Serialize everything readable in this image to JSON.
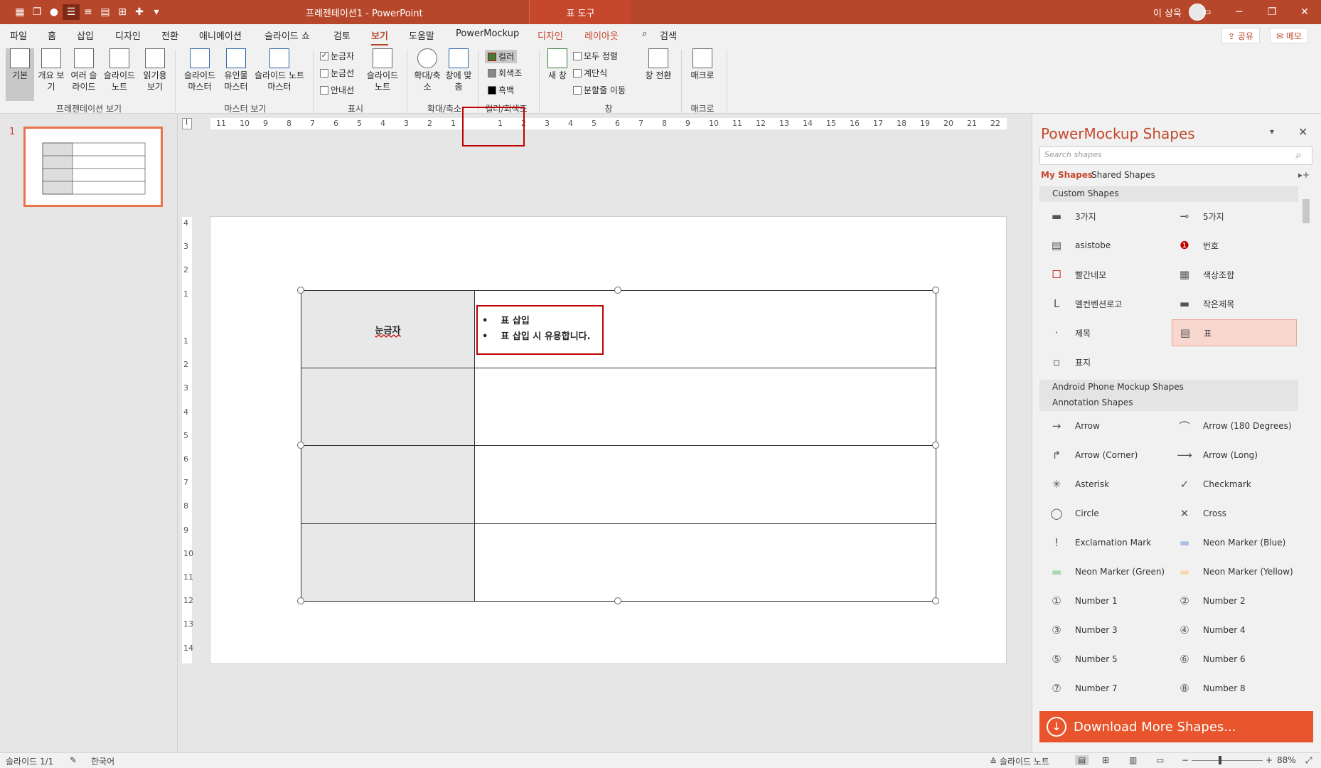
{
  "app": {
    "title": "프레젠테이션1 - PowerPoint",
    "context_tab": "표 도구",
    "user": "이 상욱"
  },
  "tabs": [
    "파일",
    "홈",
    "삽입",
    "디자인",
    "전환",
    "애니메이션",
    "슬라이드 쇼",
    "검토",
    "보기",
    "도움말",
    "PowerMockup",
    "디자인",
    "레이아웃"
  ],
  "search_label": "검색",
  "share_label": "공유",
  "memo_label": "메모",
  "ribbon": {
    "normal": "기본",
    "outline": "개요 보기",
    "sorter": "여러 슬라이드",
    "notes": "슬라이드 노트",
    "reading": "읽기용 보기",
    "slide_master": "슬라이드 마스터",
    "handout_master": "유인물 마스터",
    "notes_master": "슬라이드 노트 마스터",
    "ruler": "눈금자",
    "gridlines": "눈금선",
    "guides": "안내선",
    "notes_pane": "슬라이드 노트",
    "zoom": "확대/축소",
    "fit": "창에 맞춤",
    "color": "컬러",
    "grayscale": "회색조",
    "bw": "흑백",
    "new_window": "새 창",
    "arrange_all": "모두 정렬",
    "cascade": "계단식",
    "move_split": "분할줄 이동",
    "switch_windows": "창 전환",
    "macros": "매크로",
    "groups": [
      "프레젠테이션 보기",
      "마스터 보기",
      "표시",
      "확대/축소",
      "컬러/회색조",
      "창",
      "매크로"
    ]
  },
  "slides": {
    "number": "1"
  },
  "table": {
    "header_cell": "눈금자",
    "bullets": [
      "표 삽입",
      "표 삽입 시 유용합니다."
    ]
  },
  "ruler_h": [
    "11",
    "10",
    "9",
    "8",
    "7",
    "6",
    "5",
    "4",
    "3",
    "2",
    "1",
    "",
    "1",
    "2",
    "3",
    "4",
    "5",
    "6",
    "7",
    "8",
    "9",
    "10",
    "11",
    "12",
    "13",
    "14",
    "15",
    "16",
    "17",
    "18",
    "19",
    "20",
    "21",
    "22"
  ],
  "ruler_v": [
    "4",
    "3",
    "2",
    "1",
    "",
    "1",
    "2",
    "3",
    "4",
    "5",
    "6",
    "7",
    "8",
    "9",
    "10",
    "11",
    "12",
    "13",
    "14"
  ],
  "pm": {
    "title": "PowerMockup Shapes",
    "search_placeholder": "Search shapes",
    "my_shapes": "My Shapes",
    "shared_shapes": "Shared Shapes",
    "sec_custom": "Custom Shapes",
    "custom": [
      "3가지",
      "5가지",
      "asistobe",
      "번호",
      "빨간네모",
      "색상조합",
      "엘컨벤션로고",
      "작은제목",
      "제목",
      "표",
      "표지"
    ],
    "sec_android": "Android Phone Mockup Shapes",
    "sec_annotation": "Annotation Shapes",
    "annotation": [
      "Arrow",
      "Arrow (180 Degrees)",
      "Arrow (Corner)",
      "Arrow (Long)",
      "Asterisk",
      "Checkmark",
      "Circle",
      "Cross",
      "Exclamation Mark",
      "Neon Marker (Blue)",
      "Neon Marker (Green)",
      "Neon Marker (Yellow)",
      "Number 1",
      "Number 2",
      "Number 3",
      "Number 4",
      "Number 5",
      "Number 6",
      "Number 7",
      "Number 8"
    ],
    "download": "Download More Shapes..."
  },
  "status": {
    "slide": "슬라이드 1/1",
    "lang": "한국어",
    "notes": "슬라이드 노트",
    "zoom": "88%"
  },
  "colors": {
    "accent": "#b7472a",
    "highlight_border": "#c00000",
    "download": "#e8542b"
  }
}
